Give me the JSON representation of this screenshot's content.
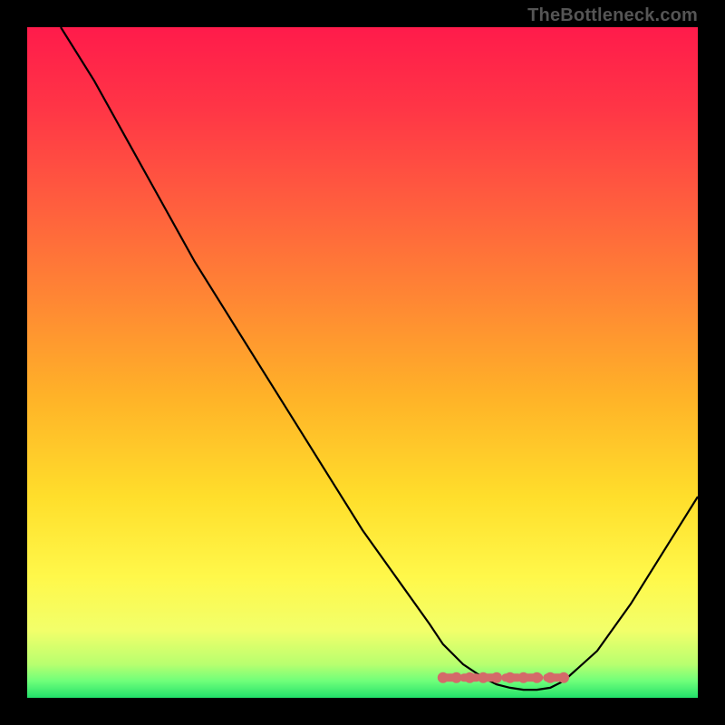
{
  "watermark": "TheBottleneck.com",
  "chart_data": {
    "type": "line",
    "title": "",
    "xlabel": "",
    "ylabel": "",
    "xlim": [
      0,
      100
    ],
    "ylim": [
      0,
      100
    ],
    "grid": false,
    "series": [
      {
        "name": "bottleneck-curve",
        "color": "#000000",
        "x": [
          5,
          10,
          15,
          20,
          25,
          30,
          35,
          40,
          45,
          50,
          55,
          60,
          62,
          65,
          68,
          70,
          72,
          74,
          76,
          78,
          80,
          85,
          90,
          95,
          100
        ],
        "y": [
          100,
          92,
          83,
          74,
          65,
          57,
          49,
          41,
          33,
          25,
          18,
          11,
          8,
          5,
          3,
          2,
          1.5,
          1.2,
          1.2,
          1.5,
          2.5,
          7,
          14,
          22,
          30
        ]
      }
    ],
    "markers": {
      "name": "optimal-zone-marker",
      "color": "#d46a6a",
      "x": [
        62,
        64,
        66,
        68,
        70,
        72,
        74,
        76,
        78,
        80
      ],
      "y": [
        3,
        3,
        3,
        3,
        3,
        3,
        3,
        3,
        3,
        3
      ]
    },
    "gradient_stops": [
      {
        "offset": 0.0,
        "color": "#ff1b4b"
      },
      {
        "offset": 0.12,
        "color": "#ff3546"
      },
      {
        "offset": 0.25,
        "color": "#ff5a3f"
      },
      {
        "offset": 0.4,
        "color": "#ff8534"
      },
      {
        "offset": 0.55,
        "color": "#ffb228"
      },
      {
        "offset": 0.7,
        "color": "#ffde2b"
      },
      {
        "offset": 0.82,
        "color": "#fff84a"
      },
      {
        "offset": 0.9,
        "color": "#f2ff6a"
      },
      {
        "offset": 0.95,
        "color": "#b8ff6f"
      },
      {
        "offset": 0.975,
        "color": "#6fff7a"
      },
      {
        "offset": 1.0,
        "color": "#22e06a"
      }
    ]
  }
}
